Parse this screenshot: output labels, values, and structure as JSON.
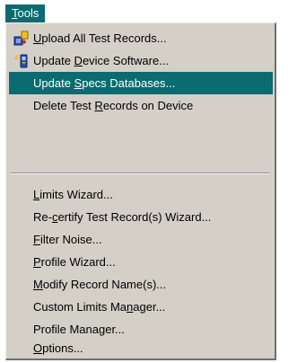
{
  "menu": {
    "title_accel": "T",
    "title_rest": "ools"
  },
  "items": [
    {
      "pre": "",
      "acc": "U",
      "post": "pload All Test Records...",
      "icon": "upload-records-icon"
    },
    {
      "pre": "Update ",
      "acc": "D",
      "post": "evice Software...",
      "icon": "update-device-icon"
    },
    {
      "pre": "Update ",
      "acc": "S",
      "post": "pecs Databases...",
      "selected": true
    },
    {
      "pre": "Delete Test ",
      "acc": "R",
      "post": "ecords on Device"
    },
    {
      "pre": "",
      "acc": "L",
      "post": "imits Wizard..."
    },
    {
      "pre": "Re-",
      "acc": "c",
      "post": "ertify Test Record(s) Wizard..."
    },
    {
      "pre": "",
      "acc": "F",
      "post": "ilter Noise..."
    },
    {
      "pre": "",
      "acc": "P",
      "post": "rofile Wizard..."
    },
    {
      "pre": "",
      "acc": "M",
      "post": "odify Record Name(s)..."
    },
    {
      "pre": "Custom Limits Ma",
      "acc": "n",
      "post": "ager..."
    },
    {
      "pre": "Profile Mana",
      "acc": "g",
      "post": "er..."
    },
    {
      "pre": "",
      "acc": "O",
      "post": "ptions..."
    }
  ],
  "colors": {
    "highlight": "#0a6b70",
    "menu_bg": "#d4d0c8"
  }
}
